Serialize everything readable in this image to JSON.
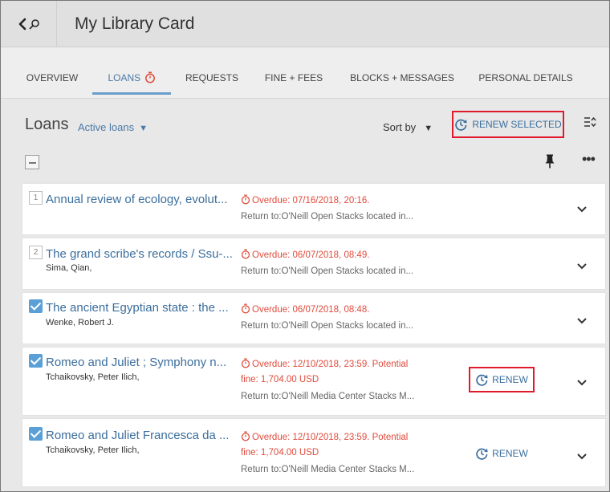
{
  "header": {
    "title": "My Library Card"
  },
  "tabs": [
    {
      "label": "OVERVIEW",
      "active": false
    },
    {
      "label": "LOANS",
      "active": true
    },
    {
      "label": "REQUESTS",
      "active": false
    },
    {
      "label": "FINE + FEES",
      "active": false
    },
    {
      "label": "BLOCKS + MESSAGES",
      "active": false
    },
    {
      "label": "PERSONAL DETAILS",
      "active": false
    }
  ],
  "toolbar": {
    "section_title": "Loans",
    "filter_value": "Active loans",
    "sort_label": "Sort by",
    "renew_selected_label": "RENEW SELECTED"
  },
  "loans": [
    {
      "index": "1",
      "checked": false,
      "title": "Annual review of ecology, evolut...",
      "author": "",
      "status": "Overdue: 07/16/2018, 20:16.",
      "fine": "",
      "return_to": "Return to:O'Neill Open Stacks located in..."
    },
    {
      "index": "2",
      "checked": false,
      "title": "The grand scribe's records / Ssu-...",
      "author": "Sima, Qian,",
      "status": "Overdue: 06/07/2018, 08:49.",
      "fine": "",
      "return_to": "Return to:O'Neill Open Stacks located in..."
    },
    {
      "index": "",
      "checked": true,
      "title": "The ancient Egyptian state : the ...",
      "author": "Wenke, Robert J.",
      "status": "Overdue: 06/07/2018, 08:48.",
      "fine": "",
      "return_to": "Return to:O'Neill Open Stacks located in..."
    },
    {
      "index": "",
      "checked": true,
      "title": "Romeo and Juliet ; Symphony n...",
      "author": "Tchaikovsky, Peter Ilich,",
      "status": "Overdue: 12/10/2018, 23:59. Potential",
      "fine": "fine: 1,704.00 USD",
      "return_to": "Return to:O'Neill Media Center Stacks M...",
      "renew_label": "RENEW"
    },
    {
      "index": "",
      "checked": true,
      "title": "Romeo and Juliet Francesca da ...",
      "author": "Tchaikovsky, Peter Ilich,",
      "status": "Overdue: 12/10/2018, 23:59. Potential",
      "fine": "fine: 1,704.00 USD",
      "return_to": "Return to:O'Neill Media Center Stacks M...",
      "renew_label": "RENEW"
    }
  ],
  "colors": {
    "accent": "#3b6e9d",
    "overdue": "#e04b3c",
    "highlight_box": "#e0192c",
    "checkbox": "#5aa0d6"
  },
  "icons": {
    "back": "chevron-left-icon",
    "search": "search-icon",
    "timer": "stopwatch-icon",
    "renew": "renew-clock-icon",
    "density": "density-toggle-icon",
    "pin": "pin-icon",
    "more": "more-horizontal-icon",
    "expand": "chevron-down-icon"
  }
}
